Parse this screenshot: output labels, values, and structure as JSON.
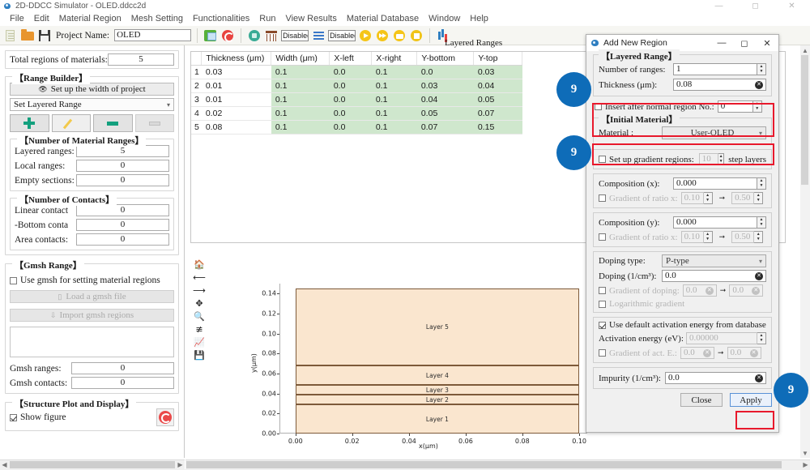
{
  "window": {
    "title": "2D-DDCC Simulator - OLED.ddcc2d",
    "icon": "app-icon",
    "minimize": "—",
    "maximize": "◻",
    "close": "✕"
  },
  "menubar": {
    "items": [
      "File",
      "Edit",
      "Material Region",
      "Mesh Setting",
      "Functionalities",
      "Run",
      "View Results",
      "Material Database",
      "Window",
      "Help"
    ]
  },
  "toolbar": {
    "project_label": "Project Name:",
    "project_value": "OLED",
    "icons": [
      "new-document-icon",
      "open-folder-icon",
      "save-icon",
      "structure-icon",
      "refresh-icon",
      "material-icon",
      "mesh-icon",
      "lines-icon",
      "run-icon",
      "run-fast-icon",
      "print-icon",
      "stop-icon",
      "chart-icon"
    ],
    "disabled_box_1": "Disabled",
    "disabled_box_2": "Disabled"
  },
  "left_panel": {
    "total_regions_label": "Total regions of materials:",
    "total_regions_value": "5",
    "range_builder": {
      "title": "【Range Builder】",
      "width_button": "Set up the width of project",
      "combo_value": "Set Layered Range",
      "buttons": [
        "add-range-button",
        "edit-range-button",
        "remove-range-button",
        "clear-range-button"
      ]
    },
    "material_ranges": {
      "title": "【Number of Material Ranges】",
      "rows": [
        {
          "label": "Layered ranges:",
          "value": "5"
        },
        {
          "label": "Local ranges:",
          "value": "0"
        },
        {
          "label": "Empty sections:",
          "value": "0"
        }
      ]
    },
    "contacts": {
      "title": "【Number of Contacts】",
      "rows": [
        {
          "label": "Linear contact",
          "value": "0"
        },
        {
          "label": "-Bottom conta",
          "value": "0"
        },
        {
          "label": "Area contacts:",
          "value": "0"
        }
      ]
    },
    "gmsh": {
      "title": "【Gmsh Range】",
      "use_gmsh_label": "Use gmsh for setting material regions",
      "use_gmsh_checked": false,
      "load_button": "Load a gmsh file",
      "import_button": "Import gmsh regions",
      "rows": [
        {
          "label": "Gmsh ranges:",
          "value": "0"
        },
        {
          "label": "Gmsh contacts:",
          "value": "0"
        }
      ]
    },
    "structure_plot": {
      "title": "【Structure Plot and Display】",
      "show_figure_label": "Show figure",
      "show_figure_checked": true,
      "refresh_icon": "refresh-plot-icon"
    }
  },
  "center": {
    "tab_label": "Layered Ranges",
    "table": {
      "columns": [
        "",
        "Thickness (μm)",
        "Width (μm)",
        "X-left",
        "X-right",
        "Y-bottom",
        "Y-top"
      ],
      "rows": [
        {
          "idx": "1",
          "thickness": "0.03",
          "width": "0.1",
          "xleft": "0.0",
          "xright": "0.1",
          "ybottom": "0.0",
          "ytop": "0.03"
        },
        {
          "idx": "2",
          "thickness": "0.01",
          "width": "0.1",
          "xleft": "0.0",
          "xright": "0.1",
          "ybottom": "0.03",
          "ytop": "0.04"
        },
        {
          "idx": "3",
          "thickness": "0.01",
          "width": "0.1",
          "xleft": "0.0",
          "xright": "0.1",
          "ybottom": "0.04",
          "ytop": "0.05"
        },
        {
          "idx": "4",
          "thickness": "0.02",
          "width": "0.1",
          "xleft": "0.0",
          "xright": "0.1",
          "ybottom": "0.05",
          "ytop": "0.07"
        },
        {
          "idx": "5",
          "thickness": "0.08",
          "width": "0.1",
          "xleft": "0.0",
          "xright": "0.1",
          "ybottom": "0.07",
          "ytop": "0.15"
        }
      ]
    },
    "plot_toolbar": [
      "home-icon",
      "back-arrow-icon",
      "forward-arrow-icon",
      "pan-icon",
      "zoom-icon",
      "configure-subplots-icon",
      "edit-axis-icon",
      "save-figure-icon"
    ]
  },
  "chart_data": {
    "type": "bar",
    "title": "",
    "xlabel": "x(μm)",
    "ylabel": "y(μm)",
    "xlim": [
      -0.005,
      0.108
    ],
    "ylim": [
      -0.004,
      0.155
    ],
    "xticks": [
      "0.00",
      "0.02",
      "0.04",
      "0.06",
      "0.08",
      "0.10"
    ],
    "xtick_values": [
      0.0,
      0.02,
      0.04,
      0.06,
      0.08,
      0.1
    ],
    "yticks": [
      "0.00",
      "0.02",
      "0.04",
      "0.06",
      "0.08",
      "0.10",
      "0.12",
      "0.14"
    ],
    "ytick_values": [
      0.0,
      0.02,
      0.04,
      0.06,
      0.08,
      0.1,
      0.12,
      0.14
    ],
    "grid": false,
    "fill_color": "#fae6cf",
    "edge_color": "#7d5a3a",
    "layers": [
      {
        "name": "Layer 1",
        "y_bottom": 0.0,
        "y_top": 0.03,
        "x_left": 0.0,
        "x_right": 0.1
      },
      {
        "name": "Layer 2",
        "y_bottom": 0.03,
        "y_top": 0.04,
        "x_left": 0.0,
        "x_right": 0.1
      },
      {
        "name": "Layer 3",
        "y_bottom": 0.04,
        "y_top": 0.05,
        "x_left": 0.0,
        "x_right": 0.1
      },
      {
        "name": "Layer 4",
        "y_bottom": 0.05,
        "y_top": 0.07,
        "x_left": 0.0,
        "x_right": 0.1
      },
      {
        "name": "Layer 5",
        "y_bottom": 0.07,
        "y_top": 0.15,
        "x_left": 0.0,
        "x_right": 0.1
      }
    ]
  },
  "dialog": {
    "title": "Add New Region",
    "minimize": "—",
    "maximize": "◻",
    "close": "✕",
    "layered_range": {
      "title": "【Layered Range】",
      "number_of_ranges_label": "Number of ranges:",
      "number_of_ranges_value": "1",
      "thickness_label": "Thickness (μm):",
      "thickness_value": "0.08"
    },
    "insert_after": {
      "label": "Insert after normal region No.:",
      "checked": false,
      "value": "0"
    },
    "initial_material": {
      "title": "【Initial Material】",
      "material_label": "Material :",
      "material_value": "User-OLED"
    },
    "gradient_regions": {
      "label": "Set up gradient regions:",
      "checked": false,
      "value": "10",
      "suffix": "step layers"
    },
    "composition_x": {
      "label": "Composition (x):",
      "value": "0.000",
      "gradient_label": "Gradient of ratio x:",
      "gradient_checked": false,
      "from": "0.10",
      "arrow": "➞",
      "to": "0.50"
    },
    "composition_y": {
      "label": "Composition (y):",
      "value": "0.000",
      "gradient_label": "Gradient of ratio x:",
      "gradient_checked": false,
      "from": "0.10",
      "arrow": "➞",
      "to": "0.50"
    },
    "doping": {
      "type_label": "Doping type:",
      "type_value": "P-type",
      "value_label": "Doping (1/cm³):",
      "value": "0.0",
      "gradient_label": "Gradient of doping:",
      "gradient_checked": false,
      "gradient_from": "0.0",
      "arrow": "➞",
      "gradient_to": "0.0",
      "log_label": "Logarithmic gradient",
      "log_checked": false
    },
    "activation": {
      "default_label": "Use default activation energy from database",
      "default_checked": true,
      "energy_label": "Activation energy (eV):",
      "energy_value": "0.00000",
      "gradient_label": "Gradient of act. E.:",
      "gradient_checked": false,
      "gradient_from": "0.0",
      "arrow": "➞",
      "gradient_to": "0.0"
    },
    "impurity": {
      "label": "Impurity (1/cm³):",
      "value": "0.0"
    },
    "buttons": {
      "close": "Close",
      "apply": "Apply"
    }
  },
  "badges": [
    {
      "label": "9"
    },
    {
      "label": "9"
    },
    {
      "label": "9"
    }
  ],
  "colors": {
    "badge": "#0e6cb8",
    "highlight": "#e8192c",
    "table_green": "#cfe7cd",
    "layer_fill": "#fae6cf"
  }
}
